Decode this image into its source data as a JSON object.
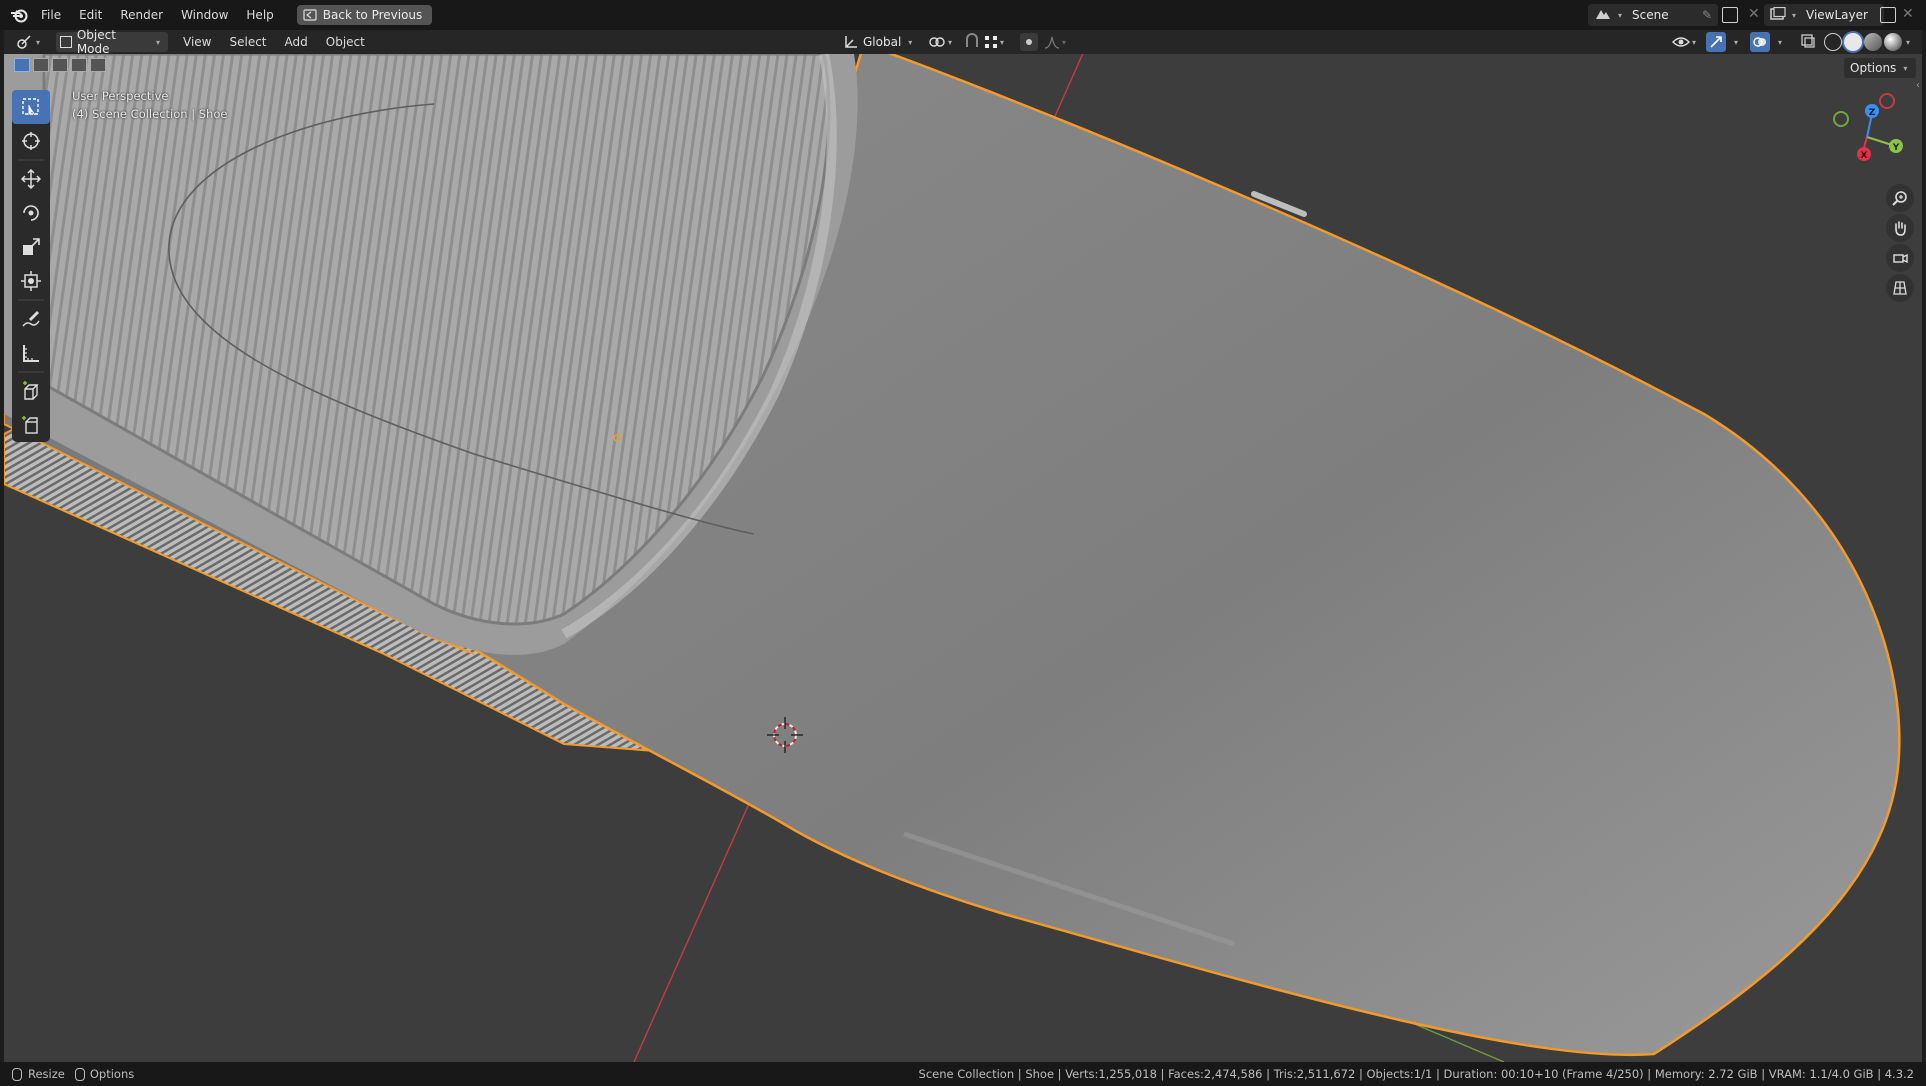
{
  "menu": {
    "items": [
      "File",
      "Edit",
      "Render",
      "Window",
      "Help"
    ],
    "back_label": "Back to Previous"
  },
  "scene": {
    "label": "Scene"
  },
  "view_layer": {
    "label": "ViewLayer"
  },
  "header": {
    "mode": "Object Mode",
    "items": [
      "View",
      "Select",
      "Add",
      "Object"
    ],
    "orientation": "Global",
    "options_label": "Options"
  },
  "viewport": {
    "perspective": "User Perspective",
    "collection": "(4) Scene Collection | Shoe"
  },
  "gizmo": {
    "x": "X",
    "y": "Y",
    "z": "Z"
  },
  "status": {
    "resize_label": "Resize",
    "options_label": "Options",
    "info": "Scene Collection | Shoe | Verts:1,255,018 | Faces:2,474,586 | Tris:2,511,672 | Objects:1/1 | Duration: 00:10+10 (Frame 4/250) | Memory: 2.72 GiB | VRAM: 1.1/4.0 GiB | 4.3.2"
  },
  "colors": {
    "accent": "#4772b3",
    "selection_outline": "#f39a2b",
    "axis_x": "#e0334a",
    "axis_y": "#8bc34a",
    "axis_z": "#3b8ef0"
  },
  "icons": [
    "blender-logo-icon",
    "back-icon",
    "scene-icon",
    "pin-icon",
    "viewlayer-icon",
    "editor-type-icon",
    "object-mode-icon",
    "global-orientation-icon",
    "pivot-icon",
    "snap-icon",
    "snap-target-icon",
    "proportional-icon",
    "falloff-icon",
    "visibility-icon",
    "gizmo-icon",
    "overlay-icon",
    "xray-icon",
    "wireframe-shading-icon",
    "solid-shading-icon",
    "material-shading-icon",
    "rendered-shading-icon",
    "select-box-icon",
    "cursor-icon",
    "move-icon",
    "rotate-icon",
    "scale-icon",
    "transform-icon",
    "annotate-icon",
    "measure-icon",
    "add-cube-icon",
    "add-object-icon",
    "zoom-icon",
    "pan-hand-icon",
    "camera-view-icon",
    "grid-ortho-icon"
  ]
}
